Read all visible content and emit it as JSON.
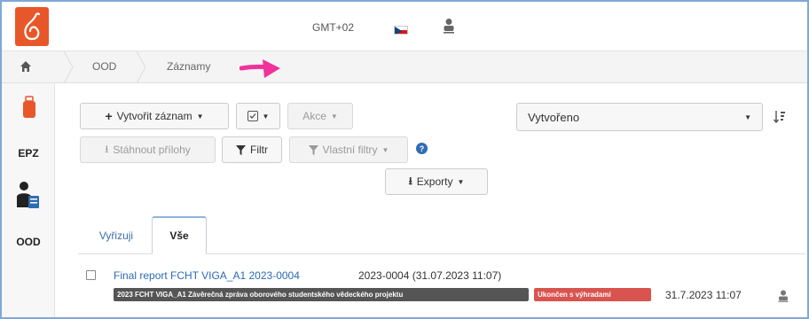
{
  "header": {
    "timezone": "GMT+02",
    "language_flag": "czech-flag-icon",
    "user_icon": "user-icon"
  },
  "breadcrumb": {
    "items": [
      "OOD",
      "Záznamy"
    ]
  },
  "sidebar": {
    "items": [
      {
        "label": "",
        "icon": "document-bag-icon"
      },
      {
        "label": "EPZ",
        "icon": ""
      },
      {
        "label": "",
        "icon": "person-document-icon"
      },
      {
        "label": "OOD",
        "icon": ""
      }
    ]
  },
  "toolbar": {
    "create_label": "Vytvořit záznam",
    "actions_label": "Akce",
    "download_label": "Stáhnout přílohy",
    "filter_label": "Filtr",
    "custom_filters_label": "Vlastní filtry",
    "exports_label": "Exporty",
    "sort_select_value": "Vytvořeno"
  },
  "tabs": [
    {
      "label": "Vyřizuji",
      "active": false
    },
    {
      "label": "Vše",
      "active": true
    }
  ],
  "records": [
    {
      "title": "Final report FCHT VIGA_A1 2023-0004",
      "id_text": "2023-0004 (31.07.2023 11:07)",
      "badge_type": "2023 FCHT VIGA_A1 Závěrečná zpráva oborového studentského vědeckého projektu",
      "badge_status": "Ukončen s výhradami",
      "date": "31.7.2023 11:07"
    }
  ],
  "colors": {
    "logo": "#e8572a",
    "link": "#2b6bb5",
    "status_badge": "#d9534f",
    "type_badge": "#555555",
    "annotation_arrow": "#f0329a"
  }
}
